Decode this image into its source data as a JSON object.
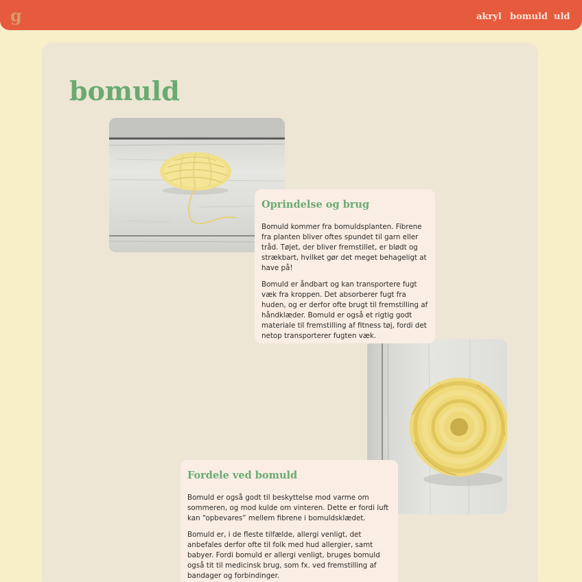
{
  "navbar": {
    "logo": "g",
    "links": [
      "akryl",
      "bomuld",
      "uld"
    ],
    "background_color": "#e65a3d"
  },
  "page": {
    "title": "bomuld",
    "background_color": "#f6efc8",
    "card_color": "#ede6d4",
    "accent_color": "#6aaa72"
  },
  "sections": [
    {
      "heading": "Oprindelse og brug",
      "paragraphs": [
        "Bomuld kommer fra bomuldsplanten. Fibrene fra planten bliver oftes spundet til garn eller tråd. Tøjet, der bliver fremstillet, er blødt og strækbart, hvilket gør det meget behageligt at have på!",
        "Bomuld er åndbart og kan transportere fugt væk fra kroppen. Det absorberer fugt fra huden, og er derfor ofte brugt til fremstilling af håndklæder. Bomuld er også et rigtig godt materiale til fremstilling af fitness tøj, fordi det netop transporterer fugten væk."
      ]
    },
    {
      "heading": "Fordele ved bomuld",
      "paragraphs": [
        "Bomuld er også godt til beskyttelse mod varme om sommeren, og mod kulde om vinteren. Dette er fordi luft kan “opbevares” mellem fibrene i bomuldsklædet.",
        "Bomuld er, i de fleste tilfælde, allergi venligt, det anbefales derfor ofte til folk med hud allergier, samt babyer. Fordi bomuld er allergi venligt, bruges bomuld også tit til medicinsk brug, som fx. ved fremstilling af bandager og forbindinger."
      ]
    }
  ]
}
